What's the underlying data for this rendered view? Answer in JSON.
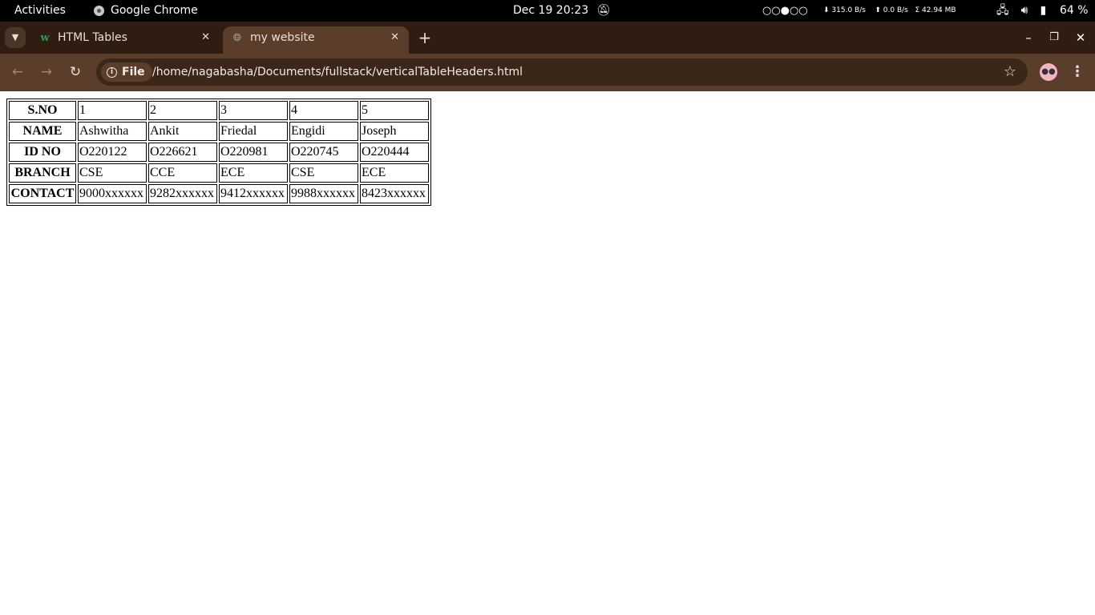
{
  "topbar": {
    "activities": "Activities",
    "app_name": "Google Chrome",
    "clock": "Dec 19  20:23",
    "workspaces": "○○●○○",
    "net_down": "⬇ 315.0 B/s",
    "net_up": "⬆ 0.0 B/s",
    "net_total": "Σ 42.94 MB",
    "battery": "64 %"
  },
  "tabs": [
    {
      "title": "HTML Tables",
      "favicon": "w3schools-icon"
    },
    {
      "title": "my website",
      "favicon": "globe-icon"
    }
  ],
  "toolbar": {
    "chip_label": "File",
    "url": "/home/nagabasha/Documents/fullstack/verticalTableHeaders.html"
  },
  "table": {
    "rows": [
      {
        "header": "S.NO",
        "cells": [
          "1",
          "2",
          "3",
          "4",
          "5"
        ]
      },
      {
        "header": "NAME",
        "cells": [
          "Ashwitha",
          "Ankit",
          "Friedal",
          "Engidi",
          "Joseph"
        ]
      },
      {
        "header": "ID NO",
        "cells": [
          "O220122",
          "O226621",
          "O220981",
          "O220745",
          "O220444"
        ]
      },
      {
        "header": "BRANCH",
        "cells": [
          "CSE",
          "CCE",
          "ECE",
          "CSE",
          "ECE"
        ]
      },
      {
        "header": "CONTACT",
        "cells": [
          "9000xxxxxx",
          "9282xxxxxx",
          "9412xxxxxx",
          "9988xxxxxx",
          "8423xxxxxx"
        ]
      }
    ]
  }
}
